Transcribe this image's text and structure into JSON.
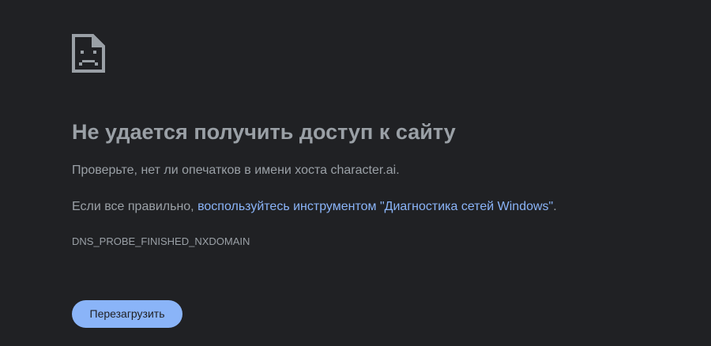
{
  "page": {
    "icon": "sad-page-icon",
    "title": "Не удается получить доступ к сайту",
    "hint_line": "Проверьте, нет ли опечатков в имени хоста character.ai.",
    "suggestion_prefix": "Если все правильно, ",
    "suggestion_link": "воспользуйтесь инструментом \"Диагностика сетей Windows\"",
    "suggestion_suffix": ".",
    "error_code": "DNS_PROBE_FINISHED_NXDOMAIN",
    "reload_label": "Перезагрузить"
  },
  "colors": {
    "background": "#202124",
    "text": "#9aa0a6",
    "link": "#8ab4f8",
    "button_background": "#8ab4f8",
    "button_text": "#202124"
  }
}
